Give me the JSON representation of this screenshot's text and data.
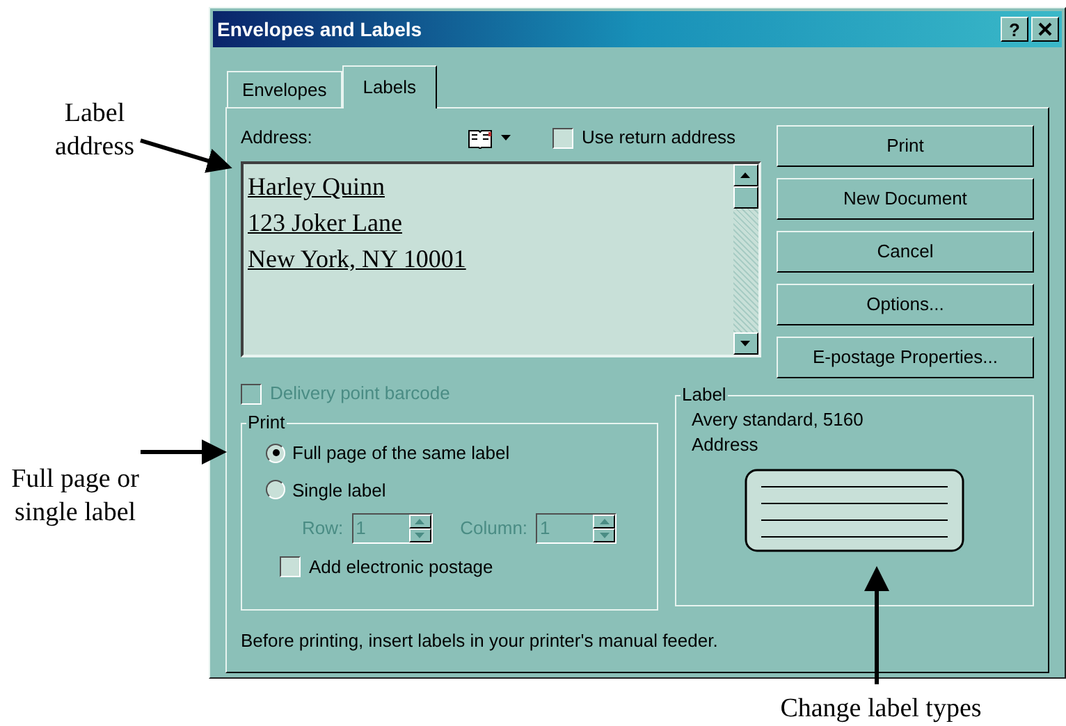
{
  "annotations": [
    {
      "kind": "address",
      "text": "Label address"
    },
    {
      "kind": "print",
      "text": "Full page or single label"
    },
    {
      "kind": "label",
      "text": "Change label types"
    }
  ],
  "window": {
    "title": "Envelopes and Labels",
    "help_button": "?"
  },
  "tabs": [
    {
      "label": "Envelopes",
      "selected": false
    },
    {
      "label": "Labels",
      "selected": true
    }
  ],
  "address": {
    "label": "Address:",
    "lines": [
      "Harley Quinn",
      "123 Joker Lane",
      "New York, NY 10001"
    ],
    "use_return_address": {
      "label": "Use return address",
      "checked": false
    }
  },
  "buttons": [
    "Print",
    "New Document",
    "Cancel",
    "Options...",
    "E-postage Properties..."
  ],
  "delivery_point_barcode": {
    "label": "Delivery point barcode",
    "checked": false,
    "disabled": true
  },
  "print_group": {
    "title": "Print",
    "options": [
      {
        "label": "Full page of the same label",
        "selected": true
      },
      {
        "label": "Single label",
        "selected": false
      }
    ],
    "row": {
      "label": "Row:",
      "value": "1",
      "disabled": true
    },
    "column": {
      "label": "Column:",
      "value": "1",
      "disabled": true
    },
    "add_postage": {
      "label": "Add electronic postage",
      "checked": false
    }
  },
  "label_group": {
    "title": "Label",
    "lines": [
      "Avery standard, 5160",
      "Address"
    ]
  },
  "footer": "Before printing, insert labels in your printer's manual feeder."
}
